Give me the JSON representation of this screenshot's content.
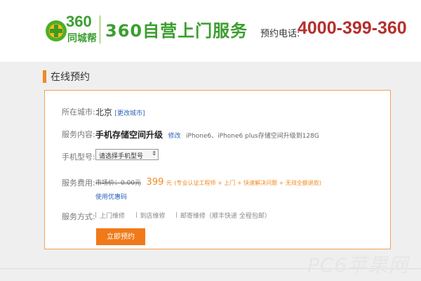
{
  "header": {
    "logo_number": "360",
    "logo_subtitle": "同城帮",
    "brand_title": "360自营上门服务",
    "hotline_label": "预约电话:",
    "hotline_number": "4000-399-360",
    "colors": {
      "brand_green": "#3b9e2f",
      "hotline_red": "#b3302d",
      "accent_orange": "#f08a24"
    }
  },
  "section": {
    "title": "在线预约"
  },
  "form": {
    "city_label": "所在城市:",
    "city_value": "北京",
    "city_change_link": "[更改城市]",
    "service_label": "服务内容:",
    "service_value": "手机存储空间升级",
    "service_edit_link": "修改",
    "service_desc": "iPhone6、iPhone6 plus存储空间升级到128G",
    "model_label": "手机型号:",
    "model_placeholder": "请选择手机型号",
    "fee_label": "服务费用:",
    "fee_original": "市场价：0.00元",
    "fee_price": "399",
    "fee_unit": "元",
    "fee_note": "(专业认证工程师 + 上门 + 快速解决问题 + 无效全额退款)",
    "coupon_link": "使用优惠码",
    "method_label": "服务方式:",
    "methods": [
      "上门维修",
      "到店维修",
      "邮寄维修（顺丰快递 全程包邮）"
    ],
    "submit_label": "立即预约"
  },
  "watermark": "PC6苹果网"
}
